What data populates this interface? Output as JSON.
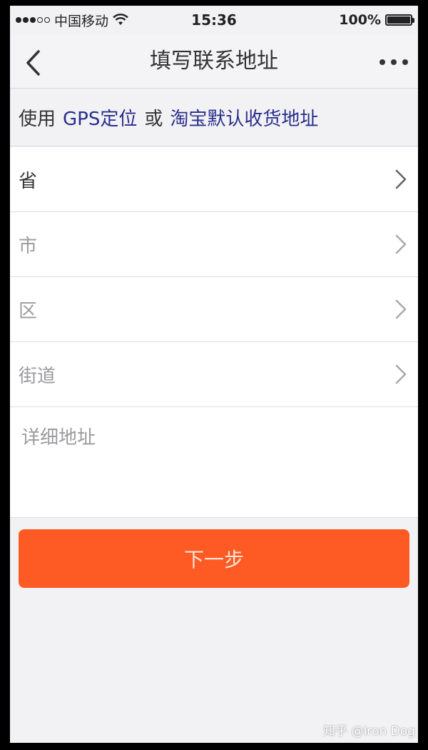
{
  "status_bar": {
    "carrier": "中国移动",
    "time": "15:36",
    "battery": "100%",
    "battery_level": 1.0
  },
  "nav": {
    "title": "填写联系地址"
  },
  "gps": {
    "prefix": "使用",
    "gps_link": "GPS定位",
    "or": "或",
    "taobao_link": "淘宝默认收货地址",
    "link_color": "#2a2e8c"
  },
  "form": {
    "province": "省",
    "city": "市",
    "district": "区",
    "street": "街道",
    "detail_placeholder": "详细地址"
  },
  "next_button": {
    "label": "下一步",
    "color": "#fe5a24"
  },
  "watermark": "知乎 @Iron Dog"
}
